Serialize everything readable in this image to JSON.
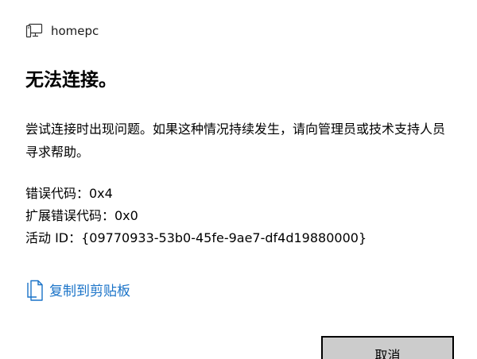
{
  "header": {
    "host_name": "homepc",
    "host_icon": "computer-icon"
  },
  "dialog": {
    "title": "无法连接。",
    "message": "尝试连接时出现问题。如果这种情况持续发生，请向管理员或技术支持人员寻求帮助。",
    "error_details": {
      "error_code": "错误代码：0x4",
      "extended_error_code": "扩展错误代码：0x0",
      "activity_id": "活动 ID：{09770933-53b0-45fe-9ae7-df4d19880000}"
    },
    "copy_link": {
      "label": "复制到剪贴板",
      "icon": "copy-icon"
    },
    "cancel_label": "取消"
  },
  "colors": {
    "link": "#1a73c8",
    "button_bg": "#cccccc",
    "button_border": "#000000"
  }
}
